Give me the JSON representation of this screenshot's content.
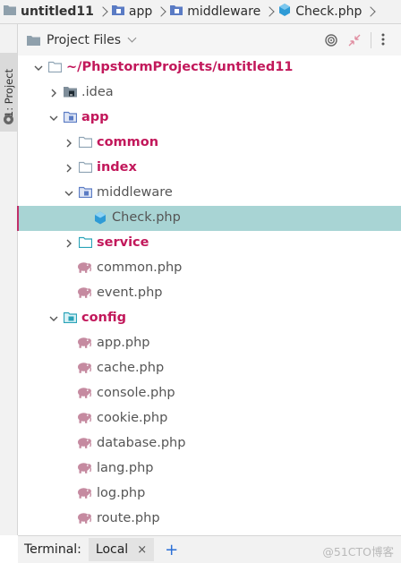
{
  "breadcrumb": [
    "untitled11",
    "app",
    "middleware",
    "Check.php"
  ],
  "side_tab": "1: Project",
  "panel": {
    "title": "Project Files"
  },
  "tree": [
    {
      "label": "~/PhpstormProjects/untitled11",
      "depth": 0,
      "arrow": "down",
      "icon": "folder",
      "style": "red"
    },
    {
      "label": ".idea",
      "depth": 1,
      "arrow": "right",
      "icon": "idea-folder",
      "style": "grey"
    },
    {
      "label": "app",
      "depth": 1,
      "arrow": "down",
      "icon": "module-folder",
      "style": "red"
    },
    {
      "label": "common",
      "depth": 2,
      "arrow": "right",
      "icon": "folder",
      "style": "red"
    },
    {
      "label": "index",
      "depth": 2,
      "arrow": "right",
      "icon": "folder",
      "style": "red"
    },
    {
      "label": "middleware",
      "depth": 2,
      "arrow": "down",
      "icon": "module-folder",
      "style": "grey"
    },
    {
      "label": "Check.php",
      "depth": 3,
      "arrow": "",
      "icon": "class",
      "style": "grey",
      "selected": true
    },
    {
      "label": "service",
      "depth": 2,
      "arrow": "right",
      "icon": "teal-folder",
      "style": "red"
    },
    {
      "label": "common.php",
      "depth": 2,
      "arrow": "",
      "icon": "php",
      "style": "grey"
    },
    {
      "label": "event.php",
      "depth": 2,
      "arrow": "",
      "icon": "php",
      "style": "grey"
    },
    {
      "label": "config",
      "depth": 1,
      "arrow": "down",
      "icon": "config-folder",
      "style": "red"
    },
    {
      "label": "app.php",
      "depth": 2,
      "arrow": "",
      "icon": "php",
      "style": "grey"
    },
    {
      "label": "cache.php",
      "depth": 2,
      "arrow": "",
      "icon": "php",
      "style": "grey"
    },
    {
      "label": "console.php",
      "depth": 2,
      "arrow": "",
      "icon": "php",
      "style": "grey"
    },
    {
      "label": "cookie.php",
      "depth": 2,
      "arrow": "",
      "icon": "php",
      "style": "grey"
    },
    {
      "label": "database.php",
      "depth": 2,
      "arrow": "",
      "icon": "php",
      "style": "grey"
    },
    {
      "label": "lang.php",
      "depth": 2,
      "arrow": "",
      "icon": "php",
      "style": "grey"
    },
    {
      "label": "log.php",
      "depth": 2,
      "arrow": "",
      "icon": "php",
      "style": "grey"
    },
    {
      "label": "route.php",
      "depth": 2,
      "arrow": "",
      "icon": "php",
      "style": "grey"
    }
  ],
  "terminal": {
    "label": "Terminal:",
    "tab": "Local",
    "add": "+",
    "close": "×"
  },
  "watermark": "@51CTO博客",
  "colors": {
    "accent_red": "#c2185b",
    "selection": "#a8d4d4",
    "folder": "#9aa7b0",
    "php_icon": "#c58aa0",
    "class_icon": "#2e9bd6"
  }
}
